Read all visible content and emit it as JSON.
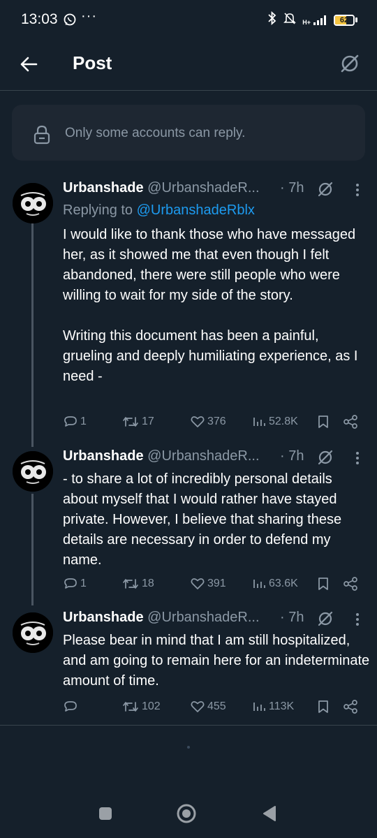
{
  "status": {
    "time": "13:03",
    "network": "H+",
    "battery": "62",
    "battery_level": 0.62,
    "icons": [
      "whatsapp-icon",
      "more-dots-icon",
      "bluetooth-icon",
      "mute-icon",
      "signal-icon",
      "battery-icon"
    ],
    "dots": "···"
  },
  "header": {
    "title": "Post"
  },
  "reply_banner": {
    "text": "Only some accounts can reply."
  },
  "tweets": [
    {
      "name": "Urbanshade",
      "handle": "@UrbanshadeR...",
      "time": "· 7h",
      "replying_prefix": "Replying to ",
      "replying_to": "@UrbanshadeRblx",
      "body": "I would like to thank those who have messaged her, as it showed me that even though I felt abandoned, there were still people who were willing to wait for my side of the story.\n\nWriting this document has been a painful, grueling and deeply humiliating experience, as I need -",
      "replies": "1",
      "reposts": "17",
      "likes": "376",
      "views": "52.8K"
    },
    {
      "name": "Urbanshade",
      "handle": "@UrbanshadeR...",
      "time": "· 7h",
      "body": "- to share a lot of incredibly personal details about myself that I would rather have stayed private. However, I believe that sharing these details are necessary in order to defend my name.",
      "replies": "1",
      "reposts": "18",
      "likes": "391",
      "views": "63.6K"
    },
    {
      "name": "Urbanshade",
      "handle": "@UrbanshadeR...",
      "time": "· 7h",
      "body": "Please bear in mind that I am still hospitalized, and am going to remain here for an indeterminate amount of time.",
      "replies": "",
      "reposts": "102",
      "likes": "455",
      "views": "113K"
    }
  ],
  "colors": {
    "background": "#15202b",
    "banner": "#1e2732",
    "accent": "#1d9bf0",
    "muted": "#8b98a5",
    "divider": "#38444d",
    "battery_fill": "#f5c542"
  }
}
